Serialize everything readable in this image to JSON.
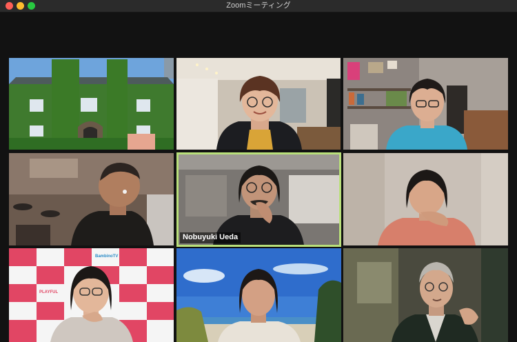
{
  "window": {
    "title": "Zoomミーティング"
  },
  "participants": [
    {
      "tile": "campus-building-background"
    },
    {
      "tile": "woman-with-glasses-mustard-top"
    },
    {
      "tile": "woman-with-glasses-blue-sweater"
    },
    {
      "tile": "man-bald-side-profile"
    },
    {
      "tile": "man-with-glasses-active-speaker",
      "name": "Nobuyuki Ueda",
      "active": true
    },
    {
      "tile": "woman-hand-on-chin"
    },
    {
      "tile": "woman-with-glasses-logo-backdrop",
      "backdrop_text": [
        "BambinoTV",
        "PLAYFUL"
      ]
    },
    {
      "tile": "woman-beach-background"
    },
    {
      "tile": "man-with-glasses-headset"
    }
  ],
  "colors": {
    "active_speaker_border": "#b9e07a",
    "window_background": "#121212",
    "close": "#ff5f57",
    "minimize": "#febc2e",
    "maximize": "#28c840"
  }
}
